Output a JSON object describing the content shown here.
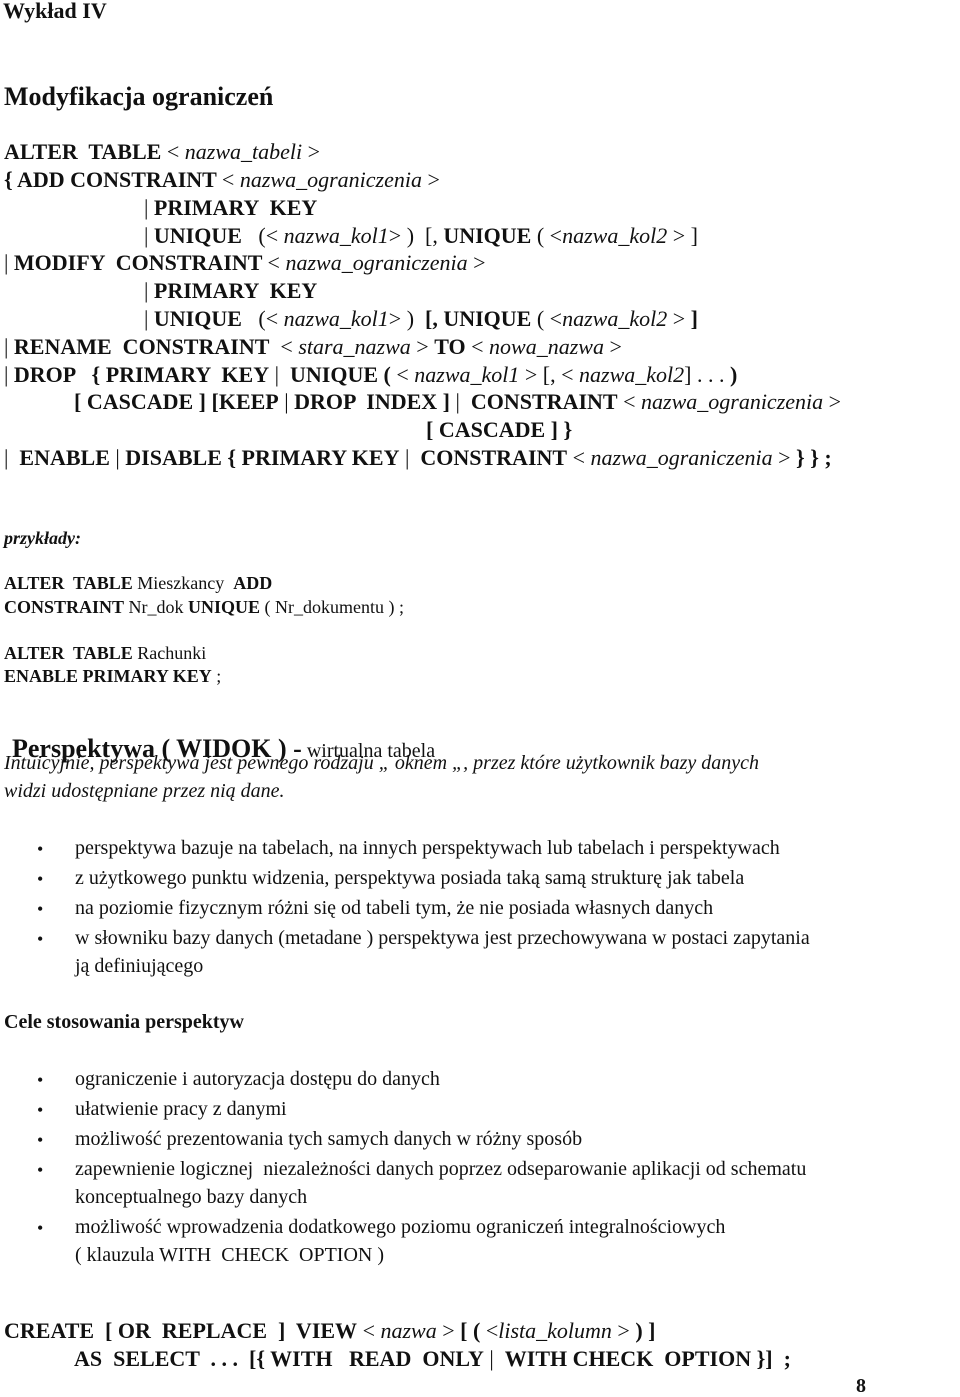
{
  "header": {
    "lecture": "Wykład IV"
  },
  "section1": {
    "title": "Modyfikacja ograniczeń",
    "syntax": [
      [
        {
          "t": "ALTER  TABLE ",
          "s": "b"
        },
        {
          "t": "< ",
          "s": "n"
        },
        {
          "t": "nazwa_tabeli",
          "s": "i"
        },
        {
          "t": " >",
          "s": "n"
        }
      ],
      [
        {
          "t": "{ ADD CONSTRAINT ",
          "s": "b"
        },
        {
          "t": "< ",
          "s": "n"
        },
        {
          "t": "nazwa_ograniczenia",
          "s": "i"
        },
        {
          "t": " >",
          "s": "n"
        }
      ],
      [
        {
          "t": "| ",
          "s": "n"
        },
        {
          "t": "PRIMARY  KEY",
          "s": "b"
        }
      ],
      [
        {
          "t": "| ",
          "s": "n"
        },
        {
          "t": "UNIQUE",
          "s": "b"
        },
        {
          "t": "   (< ",
          "s": "n"
        },
        {
          "t": "nazwa_kol1",
          "s": "i"
        },
        {
          "t": "> )  [, ",
          "s": "n"
        },
        {
          "t": "UNIQUE",
          "s": "b"
        },
        {
          "t": " ( <",
          "s": "n"
        },
        {
          "t": "nazwa_kol2",
          "s": "i"
        },
        {
          "t": " > ]",
          "s": "n"
        }
      ],
      [
        {
          "t": "| ",
          "s": "n"
        },
        {
          "t": "MODIFY  CONSTRAINT ",
          "s": "b"
        },
        {
          "t": "< ",
          "s": "n"
        },
        {
          "t": "nazwa_ograniczenia",
          "s": "i"
        },
        {
          "t": " >",
          "s": "n"
        }
      ],
      [
        {
          "t": "| ",
          "s": "n"
        },
        {
          "t": "PRIMARY  KEY",
          "s": "b"
        }
      ],
      [
        {
          "t": "| ",
          "s": "n"
        },
        {
          "t": "UNIQUE",
          "s": "b"
        },
        {
          "t": "   (< ",
          "s": "n"
        },
        {
          "t": "nazwa_kol1",
          "s": "i"
        },
        {
          "t": "> )  ",
          "s": "n"
        },
        {
          "t": "[, UNIQUE",
          "s": "b"
        },
        {
          "t": " ( <",
          "s": "n"
        },
        {
          "t": "nazwa_kol2",
          "s": "i"
        },
        {
          "t": " > ",
          "s": "n"
        },
        {
          "t": "]",
          "s": "b"
        }
      ],
      [
        {
          "t": "| ",
          "s": "n"
        },
        {
          "t": "RENAME  CONSTRAINT",
          "s": "b"
        },
        {
          "t": "  < ",
          "s": "n"
        },
        {
          "t": "stara_nazwa",
          "s": "i"
        },
        {
          "t": " > ",
          "s": "n"
        },
        {
          "t": "TO",
          "s": "b"
        },
        {
          "t": " < ",
          "s": "n"
        },
        {
          "t": "nowa_nazwa",
          "s": "i"
        },
        {
          "t": " >",
          "s": "n"
        }
      ],
      [
        {
          "t": "| ",
          "s": "n"
        },
        {
          "t": "DROP   { PRIMARY  KEY",
          "s": "b"
        },
        {
          "t": " |  ",
          "s": "n"
        },
        {
          "t": "UNIQUE (",
          "s": "b"
        },
        {
          "t": " < ",
          "s": "n"
        },
        {
          "t": "nazwa_kol1",
          "s": "i"
        },
        {
          "t": " > [, < ",
          "s": "n"
        },
        {
          "t": "nazwa_kol2",
          "s": "i"
        },
        {
          "t": "] . . . ",
          "s": "n"
        },
        {
          "t": ")",
          "s": "b"
        }
      ],
      [
        {
          "t": "[ CASCADE ] [KEEP",
          "s": "b"
        },
        {
          "t": " | ",
          "s": "n"
        },
        {
          "t": "DROP  INDEX ]",
          "s": "b"
        },
        {
          "t": " |  ",
          "s": "n"
        },
        {
          "t": "CONSTRAINT",
          "s": "b"
        },
        {
          "t": " < ",
          "s": "n"
        },
        {
          "t": "nazwa_ograniczenia",
          "s": "i"
        },
        {
          "t": " >",
          "s": "n"
        }
      ],
      [
        {
          "t": "[ CASCADE ] }",
          "s": "b"
        }
      ],
      [
        {
          "t": "|  ",
          "s": "n"
        },
        {
          "t": "ENABLE",
          "s": "b"
        },
        {
          "t": " | ",
          "s": "n"
        },
        {
          "t": "DISABLE { PRIMARY KEY",
          "s": "b"
        },
        {
          "t": " |  ",
          "s": "n"
        },
        {
          "t": "CONSTRAINT",
          "s": "b"
        },
        {
          "t": " < ",
          "s": "n"
        },
        {
          "t": "nazwa_ograniczenia",
          "s": "i"
        },
        {
          "t": " > ",
          "s": "n"
        },
        {
          "t": "} } ;",
          "s": "b"
        }
      ]
    ]
  },
  "examples": {
    "label": "przykłady:",
    "lines": [
      [
        {
          "t": "ALTER  TABLE",
          "s": "b"
        },
        {
          "t": " Mieszkancy  ",
          "s": "n"
        },
        {
          "t": "ADD",
          "s": "b"
        }
      ],
      [
        {
          "t": "CONSTRAINT",
          "s": "b"
        },
        {
          "t": " Nr_dok ",
          "s": "n"
        },
        {
          "t": "UNIQUE",
          "s": "b"
        },
        {
          "t": " ( Nr_dokumentu ) ;",
          "s": "n"
        }
      ],
      [
        {
          "t": "ALTER  TABLE",
          "s": "b"
        },
        {
          "t": " Rachunki",
          "s": "n"
        }
      ],
      [
        {
          "t": "ENABLE PRIMARY KEY",
          "s": "b"
        },
        {
          "t": " ;",
          "s": "n"
        }
      ]
    ]
  },
  "view": {
    "title": "Perspektywa ( WIDOK ) -",
    "subtitle": " wirtualna tabela",
    "intro_line1": "Intuicyjnie, perspektywa jest pewnego rodzaju „ oknem „, przez które użytkownik bazy danych",
    "intro_line2": "widzi udostępniane przez nią dane.",
    "bullets": [
      [
        "perspektywa bazuje na tabelach, na innych perspektywach lub tabelach i perspektywach"
      ],
      [
        "z użytkowego punktu widzenia, perspektywa posiada taką samą strukturę jak tabela"
      ],
      [
        "na poziomie fizycznym różni się od tabeli tym, że nie posiada własnych danych"
      ],
      [
        "w słowniku bazy danych (metadane ) perspektywa jest przechowywana w postaci zapytania",
        "ją definiującego"
      ]
    ]
  },
  "goals": {
    "title": "Cele stosowania perspektyw",
    "bullets": [
      [
        "ograniczenie i autoryzacja dostępu do danych"
      ],
      [
        "ułatwienie pracy z danymi"
      ],
      [
        "możliwość prezentowania tych samych danych w różny sposób"
      ],
      [
        "zapewnienie logicznej  niezależności danych poprzez odseparowanie aplikacji od schematu",
        "konceptualnego bazy danych"
      ],
      [
        "możliwość wprowadzenia dodatkowego poziomu ograniczeń integralnościowych",
        "( klauzula WITH  CHECK  OPTION )"
      ]
    ]
  },
  "create_view": {
    "lines": [
      [
        {
          "t": "CREATE  [ OR  REPLACE  ]  VIEW",
          "s": "b"
        },
        {
          "t": " < ",
          "s": "n"
        },
        {
          "t": "nazwa",
          "s": "i"
        },
        {
          "t": " > ",
          "s": "n"
        },
        {
          "t": "[ (",
          "s": "b"
        },
        {
          "t": " <",
          "s": "n"
        },
        {
          "t": "lista_kolumn",
          "s": "i"
        },
        {
          "t": " > ",
          "s": "n"
        },
        {
          "t": ") ]",
          "s": "b"
        }
      ],
      [
        {
          "t": "AS  SELECT  . . .  [{ WITH   READ  ONLY",
          "s": "b"
        },
        {
          "t": " |  ",
          "s": "n"
        },
        {
          "t": "WITH CHECK  OPTION }]  ;",
          "s": "b"
        }
      ]
    ]
  },
  "footer": {
    "page_number": "8"
  },
  "bullet_glyph": "•"
}
